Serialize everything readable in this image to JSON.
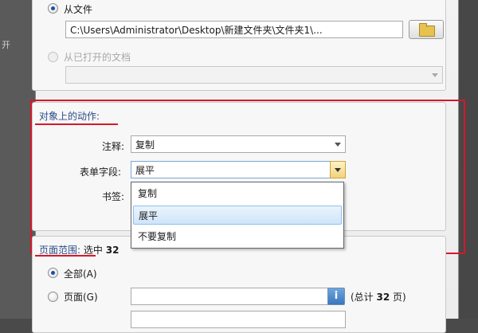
{
  "left_clipped_text": "开",
  "source": {
    "from_file_label": "从文件",
    "file_path": "C:\\Users\\Administrator\\Desktop\\新建文件夹\\文件夹1\\...",
    "from_open_doc_label": "从已打开的文档",
    "open_doc_value": ""
  },
  "actions": {
    "section_title": "对象上的动作:",
    "comments_label": "注释:",
    "comments_value": "复制",
    "form_fields_label": "表单字段:",
    "form_fields_value": "展平",
    "bookmarks_label": "书签:",
    "dropdown_options": [
      "复制",
      "展平",
      "不要复制"
    ],
    "dropdown_selected": "展平"
  },
  "page_range": {
    "section_title": "页面范围:",
    "selected_prefix": "选中",
    "selected_count": "32",
    "all_label": "全部(A)",
    "pages_label": "页面(G)",
    "pages_value": "",
    "total_prefix": "(总计",
    "total_count": "32",
    "total_suffix": "页)"
  },
  "colors": {
    "annotation_red": "#d11a2a",
    "section_title_blue": "#2b4b8a",
    "selection_blue": "#cfe5fa"
  }
}
